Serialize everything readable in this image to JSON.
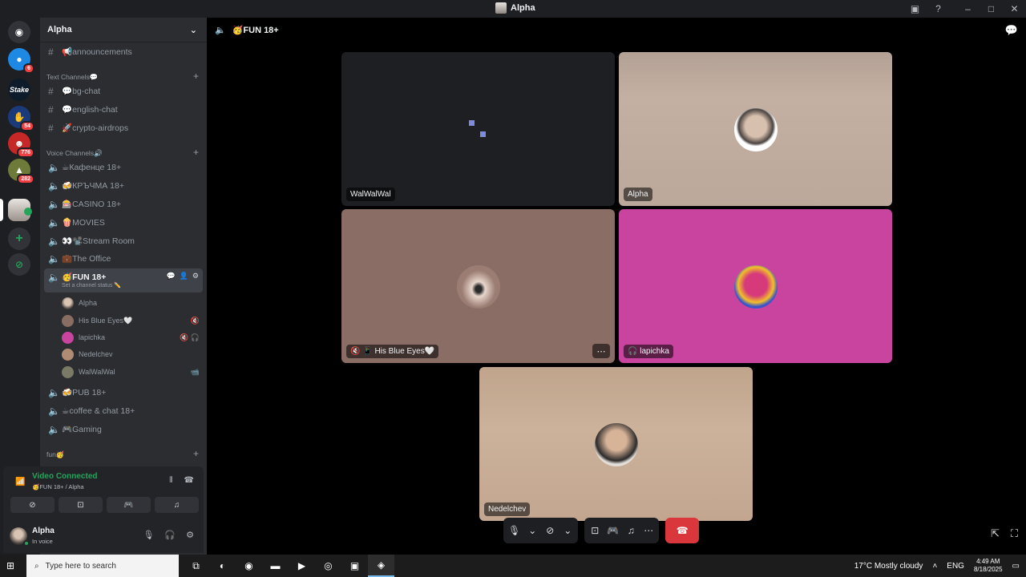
{
  "window": {
    "title": "Alpha"
  },
  "titlebar_icons": [
    "inbox-icon",
    "help-icon",
    "minimize-icon",
    "maximize-icon",
    "close-icon"
  ],
  "servers": [
    {
      "name": "discord-home",
      "badge": ""
    },
    {
      "name": "server-1",
      "badge": "6"
    },
    {
      "name": "stake",
      "badge": ""
    },
    {
      "name": "server-3",
      "badge": "54"
    },
    {
      "name": "server-4",
      "badge": "776"
    },
    {
      "name": "server-5",
      "badge": "282"
    },
    {
      "name": "alpha",
      "badge": ""
    }
  ],
  "guild": {
    "name": "Alpha"
  },
  "channels": {
    "announcements": "📢announcements",
    "text_category": "Text Channels💬",
    "text": [
      "💬bg-chat",
      "💬english-chat",
      "🚀crypto-airdrops"
    ],
    "voice_category": "Voice Channels🔊",
    "voice": [
      "☕Кафенце 18+",
      "🍻КРЪЧМА 18+",
      "🎰CASINO 18+",
      "🍿MOVIES",
      "👀📽️Stream Room",
      "💼The Office"
    ],
    "active": {
      "name": "🥳FUN 18+",
      "status": "Set a channel status ✏️"
    },
    "members": [
      {
        "name": "Alpha",
        "icons": ""
      },
      {
        "name": "His Blue Eyes🤍",
        "icons": "🔇"
      },
      {
        "name": "lapichka",
        "icons": "🔇 🎧"
      },
      {
        "name": "Nedelchev",
        "icons": ""
      },
      {
        "name": "WalWalWal",
        "icons": "📹"
      }
    ],
    "voice_after": [
      "🍻PUB 18+",
      "☕coffee & chat 18+",
      "🎮Gaming"
    ],
    "fun_category": "fun🥳"
  },
  "voice_panel": {
    "status": "Video Connected",
    "sub": "🥳FUN 18+ / Alpha"
  },
  "user_panel": {
    "name": "Alpha",
    "status": "In voice"
  },
  "stage": {
    "channel": "🥳FUN 18+",
    "tiles": [
      {
        "label": "WalWalWal"
      },
      {
        "label": "Alpha"
      },
      {
        "label": "🔇 📱 His Blue Eyes🤍"
      },
      {
        "label": "🎧 lapichka"
      },
      {
        "label": "Nedelchev"
      }
    ]
  },
  "taskbar": {
    "search_placeholder": "Type here to search",
    "weather": "17°C  Mostly cloudy",
    "lang": "ENG",
    "time": "4:49 AM",
    "date": "8/18/2025"
  },
  "colors": {
    "accent_green": "#23a55a",
    "danger": "#da373c",
    "sidebar": "#2b2d31",
    "rail": "#1e1f22",
    "tile_pink": "#c9449e"
  }
}
